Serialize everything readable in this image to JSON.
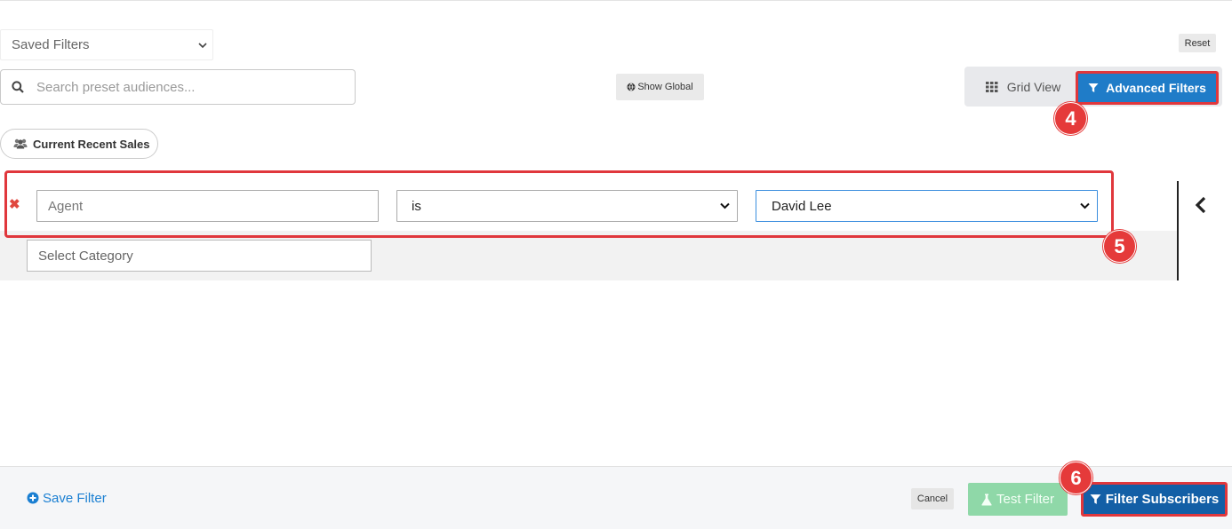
{
  "header": {
    "saved_filters": {
      "selected": "Saved Filters"
    },
    "reset_label": "Reset",
    "search": {
      "placeholder": "Search preset audiences...",
      "value": ""
    },
    "show_global_label": "Show Global",
    "view_toggle": {
      "grid_view_label": "Grid View",
      "advanced_filters_label": "Advanced Filters",
      "active": "Advanced Filters"
    }
  },
  "preset_chip": {
    "label": "Current Recent Sales",
    "icon": "users-icon"
  },
  "filter_rule": {
    "field_placeholder": "Agent",
    "operator": "is",
    "value": "David Lee"
  },
  "category": {
    "placeholder": "Select Category"
  },
  "footer": {
    "save_filter_label": "Save Filter",
    "cancel_label": "Cancel",
    "test_filter_label": "Test Filter",
    "filter_subscribers_label": "Filter Subscribers"
  },
  "annotations": {
    "step_4": "4",
    "step_5": "5",
    "step_6": "6"
  },
  "colors": {
    "primary_blue": "#1f7cc8",
    "dark_blue": "#135fa6",
    "highlight_red": "#e0373c",
    "test_green": "#8fd8a8",
    "link_blue": "#1a7fd2"
  }
}
